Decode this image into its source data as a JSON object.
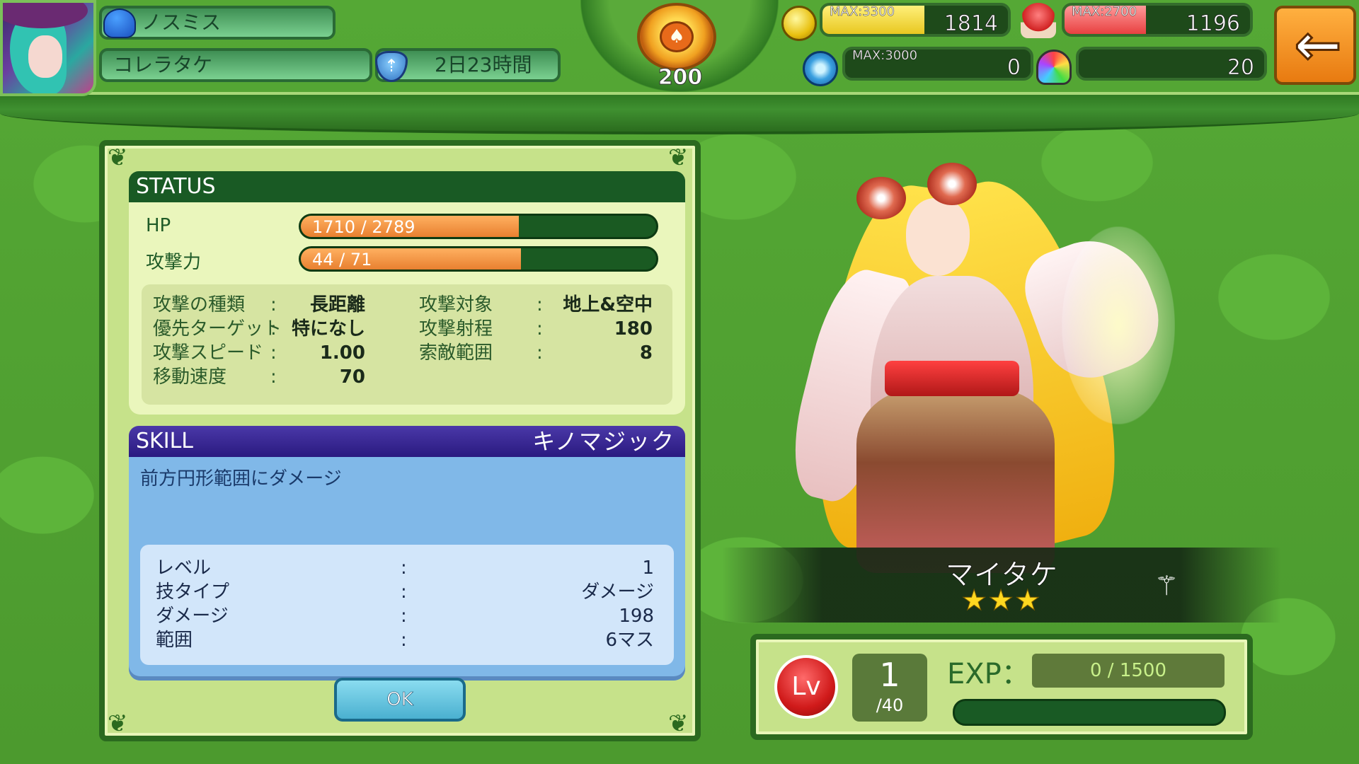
{
  "header": {
    "player_name": "ノスミス",
    "category": "コレラタケ",
    "time_remaining": "2日23時間",
    "emblem_value": "200",
    "gold": {
      "max": "MAX:3300",
      "value": "1814",
      "fill": 0.55
    },
    "spores": {
      "max": "MAX:2700",
      "value": "1196",
      "fill": 0.44
    },
    "crystal": {
      "max": "MAX:3000",
      "value": "0",
      "fill": 0
    },
    "rainbow": {
      "value": "20"
    },
    "back_label": "←"
  },
  "status": {
    "title": "STATUS",
    "hp": {
      "label": "HP",
      "text": "1710 / 2789",
      "fill": 0.613
    },
    "atk": {
      "label": "攻撃力",
      "text": "44 / 71",
      "fill": 0.62
    },
    "colon": ":",
    "attrs": {
      "attack_type": {
        "k": "攻撃の種類",
        "v": "長距離"
      },
      "priority_target": {
        "k": "優先ターゲット",
        "v": "特になし"
      },
      "attack_speed": {
        "k": "攻撃スピード",
        "v": "1.00"
      },
      "move_speed": {
        "k": "移動速度",
        "v": "70"
      },
      "attack_target": {
        "k": "攻撃対象",
        "v": "地上&空中"
      },
      "attack_range": {
        "k": "攻撃射程",
        "v": "180"
      },
      "search_range": {
        "k": "索敵範囲",
        "v": "8"
      }
    }
  },
  "skill": {
    "title": "SKILL",
    "name": "キノマジック",
    "description": "前方円形範囲にダメージ",
    "rows": [
      {
        "k": "レベル",
        "v": "1"
      },
      {
        "k": "技タイプ",
        "v": "ダメージ"
      },
      {
        "k": "ダメージ",
        "v": "198"
      },
      {
        "k": "範囲",
        "v": "6マス"
      }
    ]
  },
  "ok_label": "OK",
  "character": {
    "name": "マイタケ",
    "stars": "★★★",
    "type_icon": "weapon-icon"
  },
  "level": {
    "badge": "Lv",
    "current": "1",
    "max": "/40",
    "exp_label": "EXP：",
    "exp_text": "0 / 1500",
    "exp_fill": 0
  }
}
